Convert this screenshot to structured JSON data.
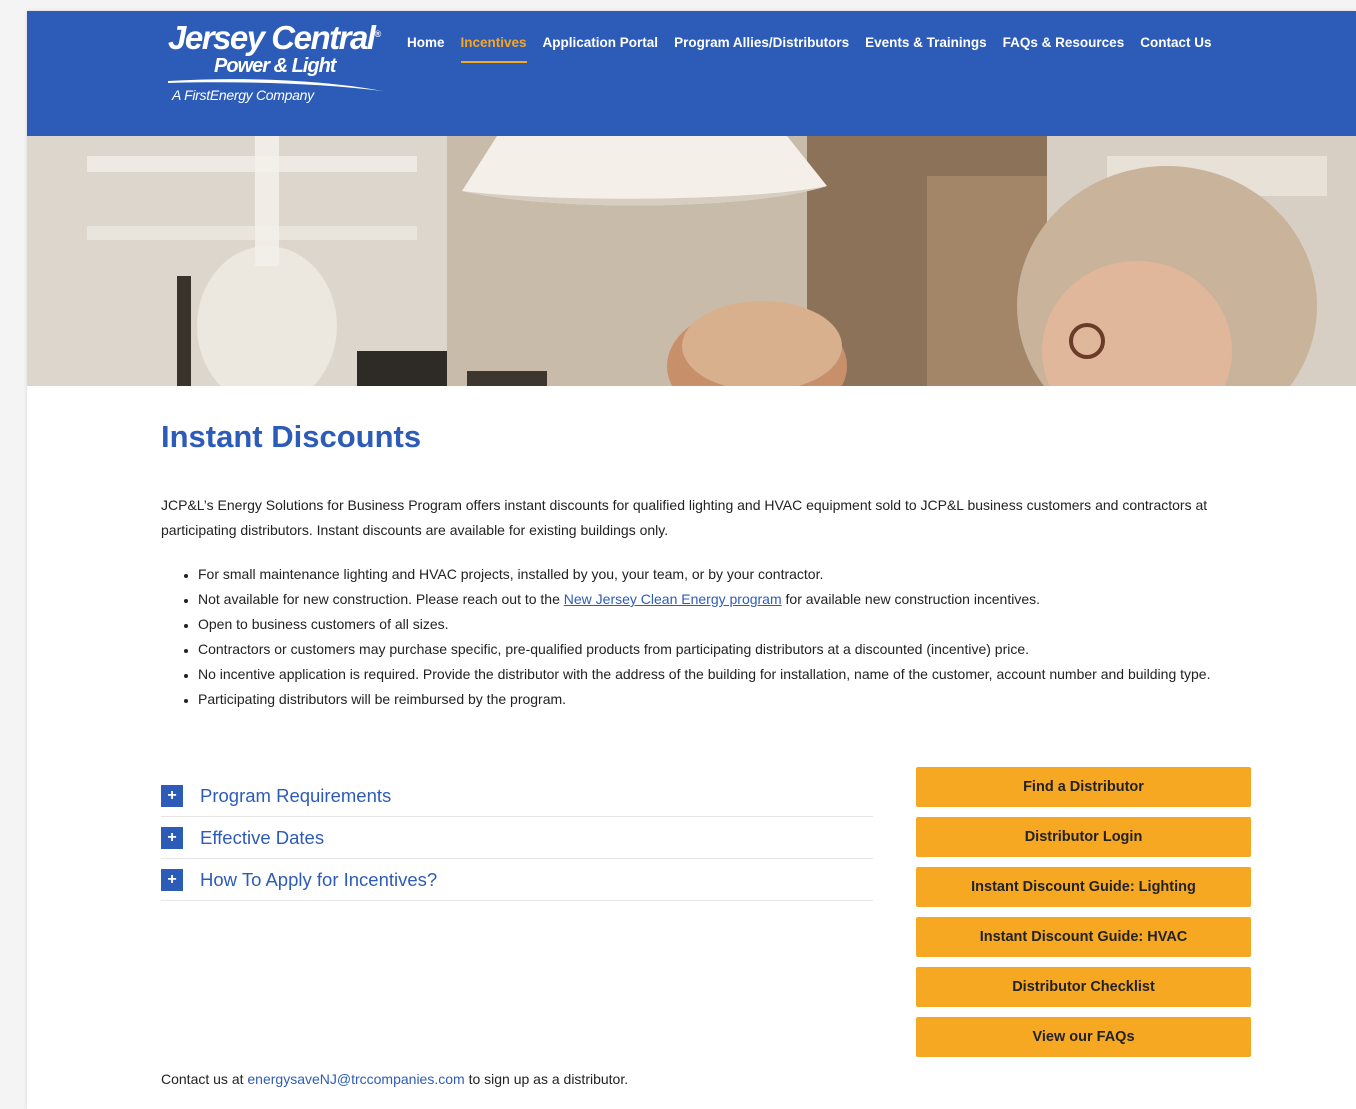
{
  "brand": {
    "name_line1": "Jersey Central",
    "name_line2": "Power & Light",
    "tagline": "A FirstEnergy Company",
    "registered_mark": "®"
  },
  "nav": {
    "items": [
      {
        "label": "Home",
        "active": false
      },
      {
        "label": "Incentives",
        "active": true
      },
      {
        "label": "Application Portal",
        "active": false
      },
      {
        "label": "Program Allies/Distributors",
        "active": false
      },
      {
        "label": "Events & Trainings",
        "active": false
      },
      {
        "label": "FAQs & Resources",
        "active": false
      },
      {
        "label": "Contact Us",
        "active": false
      }
    ]
  },
  "page": {
    "title": "Instant Discounts",
    "intro": "JCP&L’s Energy Solutions for Business Program offers instant discounts for qualified lighting and HVAC equipment sold to JCP&L business customers and contractors at participating distributors. Instant discounts are available for existing buildings only."
  },
  "bullets": {
    "b1": "For small maintenance lighting and HVAC projects, installed by you, your team, or by your contractor.",
    "b2_before": "Not available for new construction. Please reach out to the ",
    "b2_link": "New Jersey Clean Energy program",
    "b2_after": " for available new construction incentives.",
    "b3": "Open to business customers of all sizes.",
    "b4": "Contractors or customers may purchase specific, pre-qualified products from participating distributors at a discounted (incentive) price.",
    "b5": "No incentive application is required. Provide the distributor with the address of the building for installation, name of the customer, account number and building type.",
    "b6": "Participating distributors will be reimbursed by the program."
  },
  "accordion": [
    {
      "label": "Program Requirements",
      "icon": "+"
    },
    {
      "label": "Effective Dates",
      "icon": "+"
    },
    {
      "label": "How To Apply for Incentives?",
      "icon": "+"
    }
  ],
  "buttons": [
    "Find a Distributor",
    "Distributor Login",
    "Instant Discount Guide: Lighting",
    "Instant Discount Guide: HVAC",
    "Distributor Checklist",
    "View our FAQs"
  ],
  "contact": {
    "before": "Contact us at ",
    "email": "energysaveNJ@trccompanies.com",
    "after": " to sign up as a distributor."
  },
  "colors": {
    "brand_blue": "#2d5cb8",
    "accent_orange": "#f6a623",
    "button_orange": "#f7a822"
  }
}
